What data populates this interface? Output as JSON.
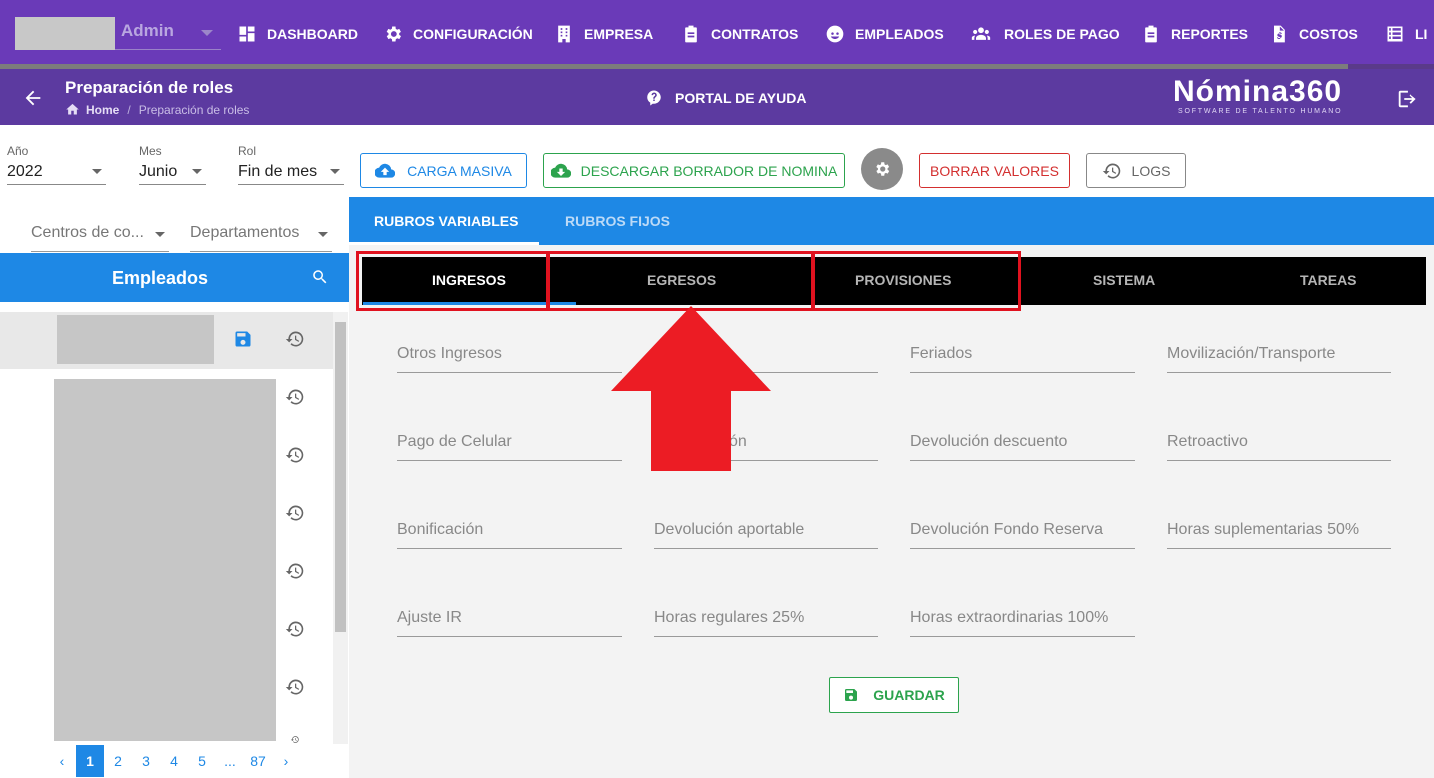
{
  "topnav": {
    "user_role": "Admin",
    "items": [
      {
        "label": "DASHBOARD",
        "icon": "dashboard-icon"
      },
      {
        "label": "CONFIGURACIÓN",
        "icon": "gear-icon"
      },
      {
        "label": "EMPRESA",
        "icon": "building-icon"
      },
      {
        "label": "CONTRATOS",
        "icon": "clipboard-icon"
      },
      {
        "label": "EMPLEADOS",
        "icon": "face-icon"
      },
      {
        "label": "ROLES DE PAGO",
        "icon": "users-icon"
      },
      {
        "label": "REPORTES",
        "icon": "clipboard-icon"
      },
      {
        "label": "COSTOS",
        "icon": "file-dollar-icon"
      },
      {
        "label": "LI",
        "icon": "list-icon"
      }
    ],
    "progress": 0.94
  },
  "header": {
    "title": "Preparación de roles",
    "breadcrumb_home": "Home",
    "breadcrumb_current": "Preparación de roles",
    "help_label": "PORTAL DE AYUDA",
    "logo": "Nómina360",
    "logo_sub": "SOFTWARE DE TALENTO HUMANO"
  },
  "filters": {
    "year_label": "Año",
    "year_value": "2022",
    "month_label": "Mes",
    "month_value": "Junio",
    "rol_label": "Rol",
    "rol_value": "Fin de mes",
    "cost_center_placeholder": "Centros de co...",
    "departments_placeholder": "Departamentos"
  },
  "toolbar": {
    "bulk_upload": "CARGA MASIVA",
    "download_draft": "DESCARGAR BORRADOR DE NOMINA",
    "clear_values": "BORRAR VALORES",
    "logs": "LOGS"
  },
  "employees": {
    "title": "Empleados",
    "pagination": [
      "1",
      "2",
      "3",
      "4",
      "5",
      "...",
      "87"
    ],
    "current_page": "1"
  },
  "tabs": [
    "RUBROS VARIABLES",
    "RUBROS FIJOS"
  ],
  "subtabs": [
    "INGRESOS",
    "EGRESOS",
    "PROVISIONES",
    "SISTEMA",
    "TAREAS"
  ],
  "fields": [
    [
      "Otros Ingresos",
      "",
      "Feriados",
      "Movilización/Transporte"
    ],
    [
      "Pago de Celular",
      "ón",
      "Devolución descuento",
      "Retroactivo"
    ],
    [
      "Bonificación",
      "Devolución aportable",
      "Devolución Fondo Reserva",
      "Horas suplementarias 50%"
    ],
    [
      "Ajuste IR",
      "Horas regulares 25%",
      "Horas extraordinarias 100%",
      ""
    ]
  ],
  "save_label": "GUARDAR",
  "colors": {
    "purple": "#6a3ab8",
    "blue": "#1e88e5",
    "green": "#2ca34d",
    "red": "#e0121f"
  }
}
